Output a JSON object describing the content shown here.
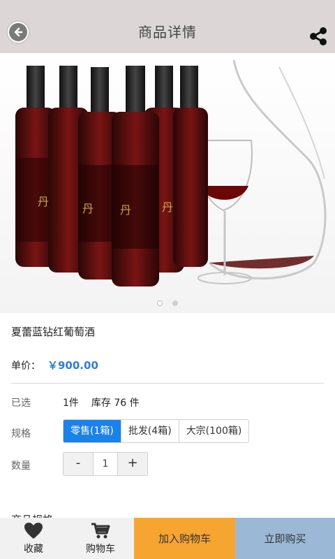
{
  "header": {
    "title": "商品详情"
  },
  "product": {
    "name": "夏蕾蓝钻红葡萄酒",
    "price_label": "单价：",
    "price": "￥900.00"
  },
  "selected": {
    "label": "已选",
    "count": "1件",
    "stock": "库存 76 件"
  },
  "spec": {
    "label": "规格",
    "options": [
      "零售(1箱)",
      "批发(4箱)",
      "大宗(100箱)"
    ],
    "selected_index": 0
  },
  "quantity": {
    "label": "数量",
    "minus": "-",
    "value": "1",
    "plus": "+"
  },
  "section_partial": "商品规格",
  "bottom_bar": {
    "favorite": "收藏",
    "cart": "购物车",
    "add_to_cart": "加入购物车",
    "buy_now": "立即购买"
  },
  "carousel": {
    "slides": 2,
    "active": 1
  },
  "colors": {
    "header_bg": "#dcd7d6",
    "accent_blue": "#1a82e8",
    "price": "#2f7fd3",
    "cart_btn": "#f7a531",
    "buy_btn": "#9bb9d6"
  }
}
